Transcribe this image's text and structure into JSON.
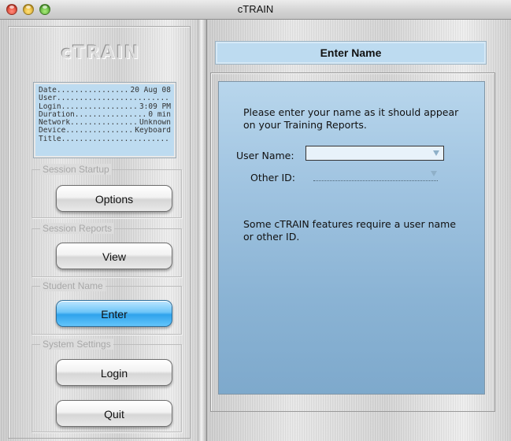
{
  "window": {
    "title": "cTRAIN"
  },
  "sidebar": {
    "logo": "cTRAIN",
    "info": [
      {
        "key": "Date",
        "value": "20 Aug 08"
      },
      {
        "key": "User",
        "value": ""
      },
      {
        "key": "Login",
        "value": "3:09 PM"
      },
      {
        "key": "Duration",
        "value": "0 min"
      },
      {
        "key": "Network",
        "value": "Unknown"
      },
      {
        "key": "Device",
        "value": "Keyboard"
      },
      {
        "key": "Title",
        "value": ""
      }
    ],
    "groups": {
      "session_startup": {
        "label": "Session Startup",
        "button": "Options"
      },
      "session_reports": {
        "label": "Session Reports",
        "button": "View"
      },
      "student_name": {
        "label": "Student Name",
        "button": "Enter"
      },
      "system_settings": {
        "label": "System Settings",
        "buttons": [
          "Login",
          "Quit"
        ]
      }
    }
  },
  "main": {
    "header": "Enter Name",
    "prompt": "Please enter your name as it should appear on your Training Reports.",
    "user_name_label": "User Name:",
    "user_name_value": "",
    "other_id_label": "Other ID:",
    "other_id_value": "",
    "note": "Some cTRAIN features require a user name or other ID."
  },
  "colors": {
    "accent_blue": "#2fa3ec",
    "panel_blue": "#bddbf0"
  }
}
